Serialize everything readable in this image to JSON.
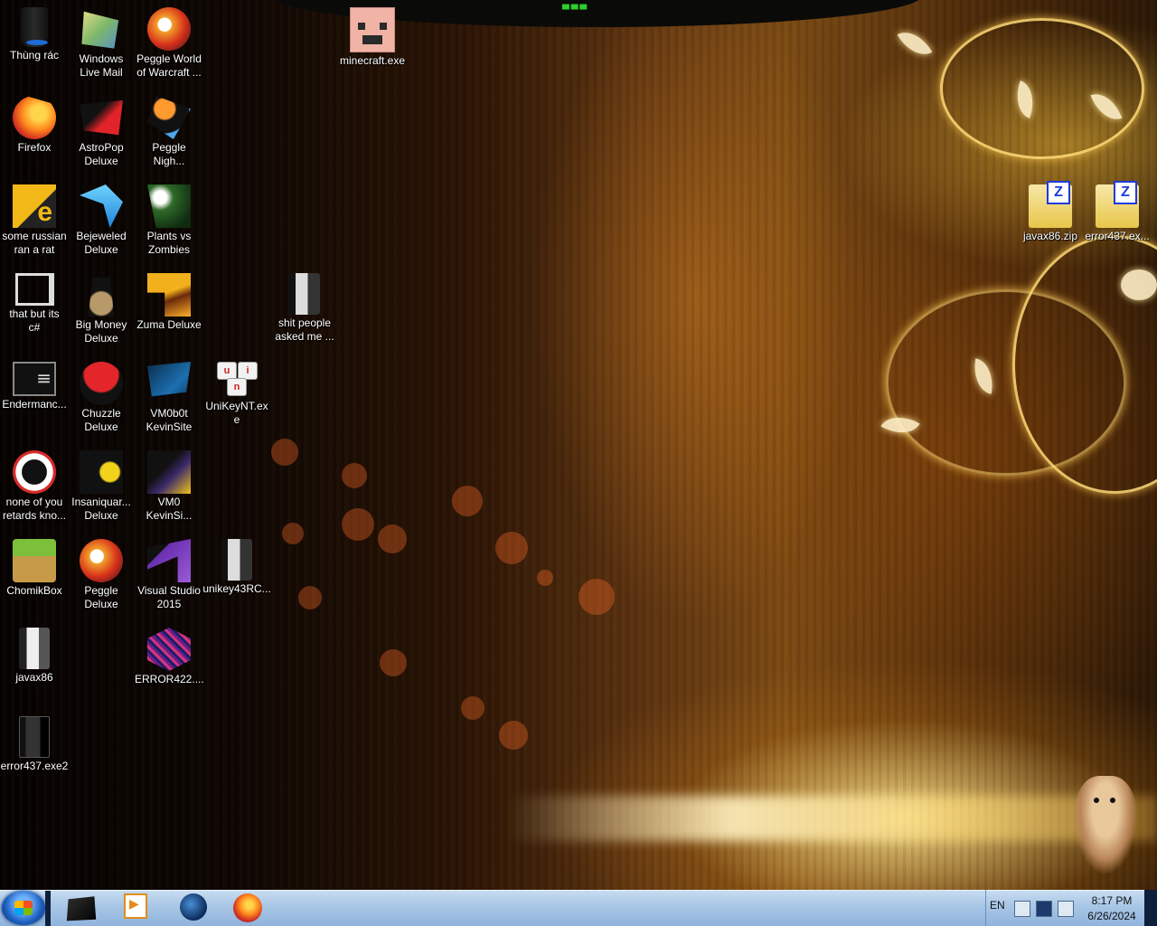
{
  "desktop": {
    "icons": {
      "recycle_bin": "Thùng rác",
      "windows_live_mail": "Windows\nLive Mail",
      "peggle_world_of_warcraft": "Peggle World\nof Warcraft ...",
      "minecraft": "minecraft.exe",
      "firefox": "Firefox",
      "astropop": "AstroPop\nDeluxe",
      "peggle_nights": "Peggle\nNigh...",
      "some_russian": "some russian\nran a rat",
      "bejeweled": "Bejeweled\nDeluxe",
      "plants_vs_zombies": "Plants vs\nZombies",
      "that_but_its_csharp": "that but its\nc#",
      "big_money": "Big Money\nDeluxe",
      "zuma": "Zuma Deluxe",
      "shit_people_asked": "shit people\nasked me ...",
      "endermanc": "Endermanc...",
      "chuzzle": "Chuzzle\nDeluxe",
      "vm0b0t": "VM0b0t\nKevinSite",
      "unikeynt": "UniKeyNT.ex\ne",
      "none_of_you": "none of you\nretards kno...",
      "insaniquarium": "Insaniquar...\nDeluxe",
      "vm0": "VM0\nKevinSi...",
      "chomikbox": "ChomikBox",
      "peggle_deluxe": "Peggle\nDeluxe",
      "visual_studio": "Visual Studio\n2015",
      "unikey43rc": "unikey43RC...",
      "javax86": "javax86",
      "error422": "ERROR422....",
      "error437_exe2": "error437.exe2",
      "javax86_zip": "javax86.zip",
      "error437_ex": "error437.ex..."
    }
  },
  "taskbar": {
    "language": "EN",
    "time": "8:17 PM",
    "date": "6/26/2024",
    "accent": "#a9c7e6"
  }
}
